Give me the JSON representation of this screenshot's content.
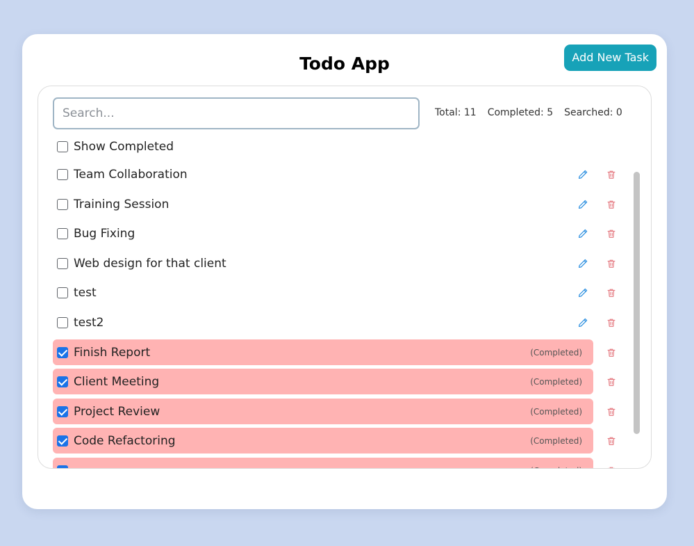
{
  "app": {
    "title": "Todo App",
    "add_button_label": "Add New Task"
  },
  "search": {
    "placeholder": "Search...",
    "value": ""
  },
  "stats": {
    "total": "Total: 11",
    "completed": "Completed: 5",
    "searched": "Searched: 0"
  },
  "filter": {
    "show_completed_label": "Show Completed",
    "show_completed_checked": false
  },
  "tasks": [
    {
      "name": "Team Collaboration",
      "completed": false
    },
    {
      "name": "Training Session",
      "completed": false
    },
    {
      "name": "Bug Fixing",
      "completed": false
    },
    {
      "name": "Web design for that client",
      "completed": false
    },
    {
      "name": "test",
      "completed": false
    },
    {
      "name": "test2",
      "completed": false
    },
    {
      "name": "Finish Report",
      "completed": true
    },
    {
      "name": "Client Meeting",
      "completed": true
    },
    {
      "name": "Project Review",
      "completed": true
    },
    {
      "name": "Code Refactoring",
      "completed": true
    },
    {
      "name": "",
      "completed": true
    }
  ],
  "completed_tag": "(Completed)",
  "icons": {
    "edit": "pencil-icon",
    "delete": "trash-icon"
  },
  "colors": {
    "background": "#c9d7f0",
    "accent": "#17a2b8",
    "completed_row": "#ffb3b3",
    "edit_icon": "#2b8fe0",
    "delete_icon": "#e57c83",
    "checkbox_checked": "#1a73e8"
  }
}
